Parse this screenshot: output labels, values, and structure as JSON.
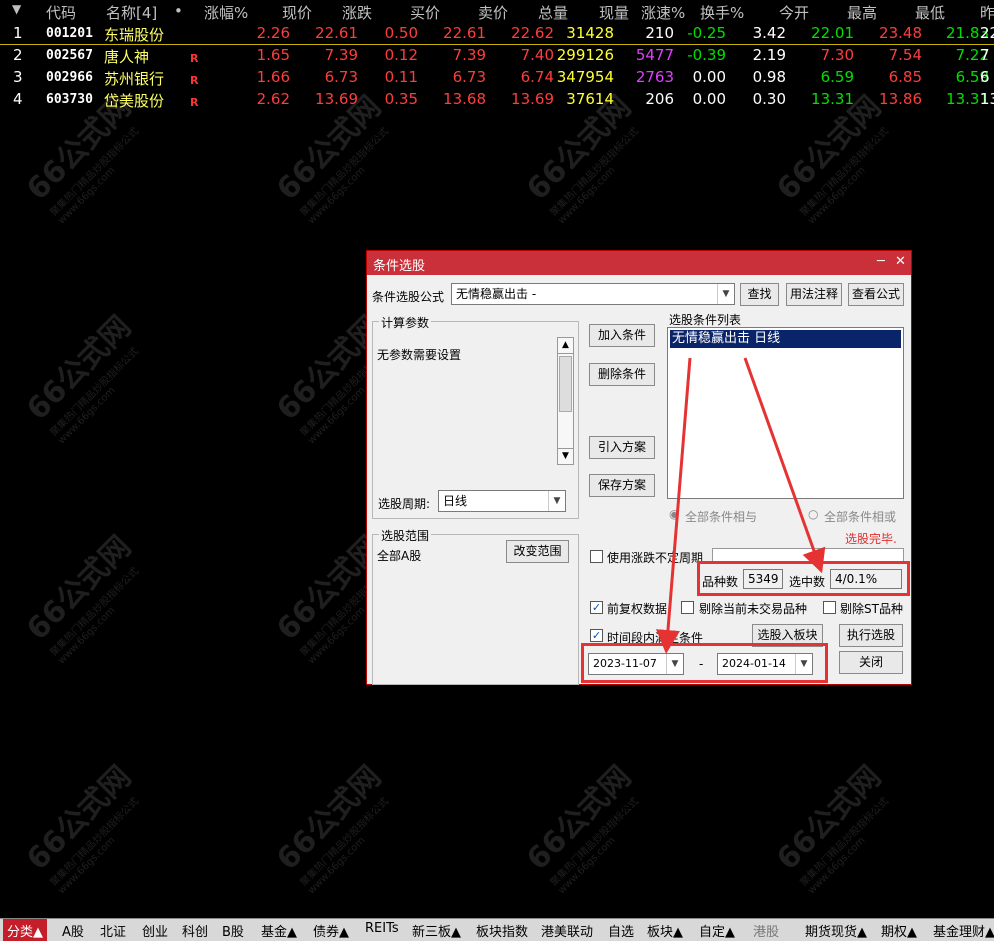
{
  "header": [
    "代码",
    "名称[4]",
    "•",
    "涨幅%",
    "现价",
    "涨跌",
    "买价",
    "卖价",
    "总量",
    "现量",
    "涨速%",
    "换手%",
    "今开",
    "最高",
    "最低",
    "昨"
  ],
  "rows": [
    {
      "i": "1",
      "code": "001201",
      "name": "东瑞股份",
      "mark": "",
      "chg": "2.26",
      "price": "22.61",
      "up": "0.50",
      "bid": "22.61",
      "ask": "22.62",
      "vol": "31428",
      "cur": "210",
      "spd": "-0.25",
      "turn": "3.42",
      "open": "22.01",
      "high": "23.48",
      "low": "21.83",
      "prev": "22"
    },
    {
      "i": "2",
      "code": "002567",
      "name": "唐人神",
      "mark": "R",
      "chg": "1.65",
      "price": "7.39",
      "up": "0.12",
      "bid": "7.39",
      "ask": "7.40",
      "vol": "299126",
      "cur": "5477",
      "spd": "-0.39",
      "turn": "2.19",
      "open": "7.30",
      "high": "7.54",
      "low": "7.22",
      "prev": "7"
    },
    {
      "i": "3",
      "code": "002966",
      "name": "苏州银行",
      "mark": "R",
      "chg": "1.66",
      "price": "6.73",
      "up": "0.11",
      "bid": "6.73",
      "ask": "6.74",
      "vol": "347954",
      "cur": "2763",
      "spd": "0.00",
      "turn": "0.98",
      "open": "6.59",
      "high": "6.85",
      "low": "6.59",
      "prev": "6"
    },
    {
      "i": "4",
      "code": "603730",
      "name": "岱美股份",
      "mark": "R",
      "chg": "2.62",
      "price": "13.69",
      "up": "0.35",
      "bid": "13.68",
      "ask": "13.69",
      "vol": "37614",
      "cur": "206",
      "spd": "0.00",
      "turn": "0.30",
      "open": "13.31",
      "high": "13.86",
      "low": "13.31",
      "prev": "13"
    }
  ],
  "dialog": {
    "title": "条件选股",
    "formula_label": "条件选股公式",
    "formula_value": "无情稳赢出击  -",
    "find": "查找",
    "usage": "用法注释",
    "view": "查看公式",
    "calc_params": "计算参数",
    "no_params": "无参数需要设置",
    "add_cond": "加入条件",
    "del_cond": "删除条件",
    "import_plan": "引入方案",
    "save_plan": "保存方案",
    "cond_list_label": "选股条件列表",
    "cond_item": "无情稳赢出击  日线",
    "period_label": "选股周期:",
    "period_value": "日线",
    "all_and": "全部条件相与",
    "all_or": "全部条件相或",
    "scope_label": "选股范围",
    "scope_value": "全部A股",
    "change_scope": "改变范围",
    "status": "选股完毕.",
    "use_unchanged": "使用涨跌不定周期",
    "count_label": "品种数",
    "count_value": "5349",
    "selected_label": "选中数",
    "selected_value": "4/0.1%",
    "fq": "前复权数据",
    "exclude_untraded": "剔除当前未交易品种",
    "exclude_st": "剔除ST品种",
    "time_cond": "时间段内满足条件",
    "to_block": "选股入板块",
    "execute": "执行选股",
    "close": "关闭",
    "date_from": "2023-11-07",
    "date_to": "2024-01-14",
    "dash": "-",
    "check_mark": "✓",
    "minimize": "─",
    "close_x": "✕"
  },
  "tabs": [
    "分类▲",
    "A股",
    "北证",
    "创业",
    "科创",
    "B股",
    "基金▲",
    "债券▲",
    "REITs",
    "新三板▲",
    "板块指数",
    "港美联动",
    "自选",
    "板块▲",
    "自定▲",
    "港股",
    "期货现货▲",
    "期权▲",
    "基金理财▲"
  ],
  "watermark": {
    "main": "66公式网",
    "sub": "聚集热门精品炒股指标公式",
    "url": "www.66gs.com"
  },
  "colors": {
    "up": "#ff3c3c",
    "down": "#00e000",
    "highlight": "#e53333"
  }
}
